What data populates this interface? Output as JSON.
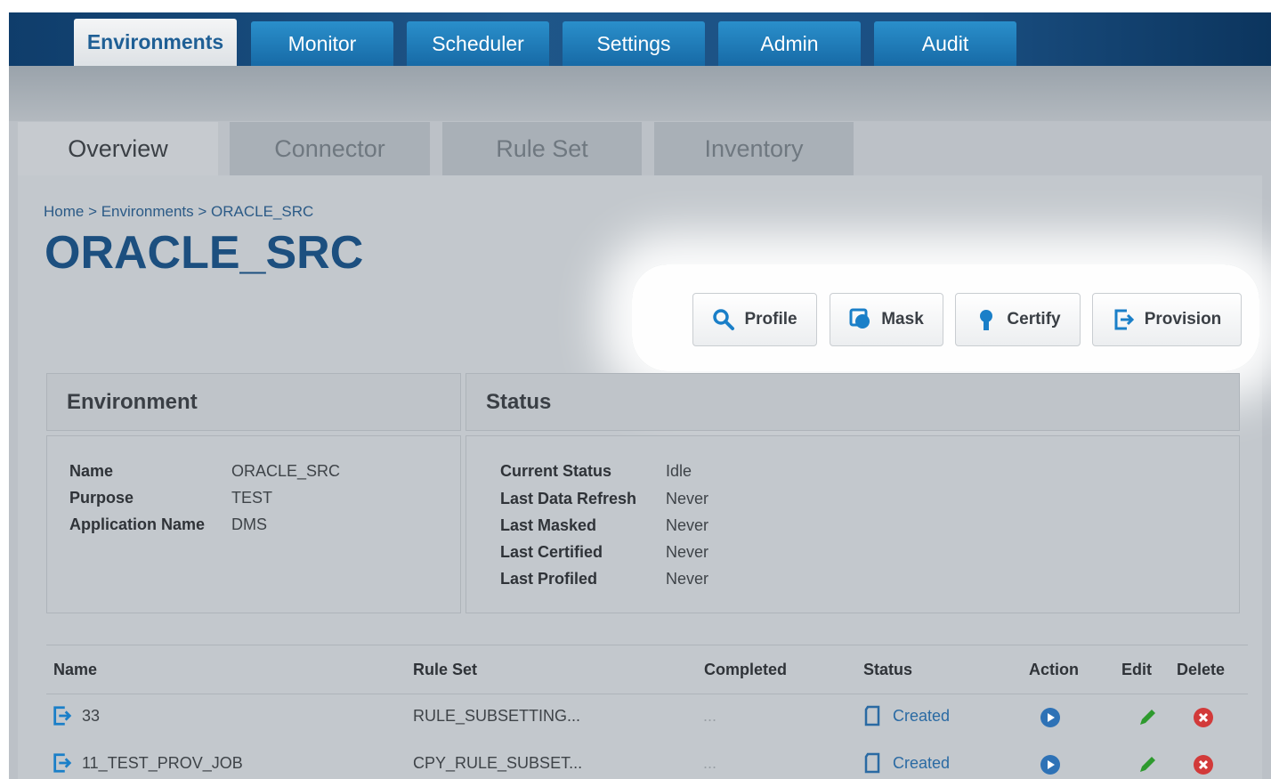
{
  "main_tabs": [
    "Environments",
    "Monitor",
    "Scheduler",
    "Settings",
    "Admin",
    "Audit"
  ],
  "sub_tabs": [
    "Overview",
    "Connector",
    "Rule Set",
    "Inventory"
  ],
  "breadcrumb": "Home > Environments > ORACLE_SRC",
  "page_title": "ORACLE_SRC",
  "actions": {
    "profile": "Profile",
    "mask": "Mask",
    "certify": "Certify",
    "provision": "Provision"
  },
  "environment": {
    "header": "Environment",
    "fields": [
      {
        "label": "Name",
        "value": "ORACLE_SRC"
      },
      {
        "label": "Purpose",
        "value": "TEST"
      },
      {
        "label": "Application Name",
        "value": "DMS"
      }
    ]
  },
  "status": {
    "header": "Status",
    "fields": [
      {
        "label": "Current Status",
        "value": "Idle"
      },
      {
        "label": "Last Data Refresh",
        "value": "Never"
      },
      {
        "label": "Last Masked",
        "value": "Never"
      },
      {
        "label": "Last Certified",
        "value": "Never"
      },
      {
        "label": "Last Profiled",
        "value": "Never"
      }
    ]
  },
  "jobs_table": {
    "columns": [
      "Name",
      "Rule Set",
      "Completed",
      "Status",
      "Action",
      "Edit",
      "Delete"
    ],
    "rows": [
      {
        "name": "33",
        "rule_set": "RULE_SUBSETTING...",
        "completed": "...",
        "status": "Created"
      },
      {
        "name": "11_TEST_PROV_JOB",
        "rule_set": "CPY_RULE_SUBSET...",
        "completed": "...",
        "status": "Created"
      }
    ]
  },
  "colors": {
    "brand_blue": "#1c4f7f",
    "tab_blue": "#176aa6",
    "link_blue": "#2a6aa3",
    "delete_red": "#d23a3a",
    "edit_green": "#2e9a2e"
  },
  "icons": {
    "profile": "magnifier-icon",
    "mask": "mask-icon",
    "certify": "ribbon-icon",
    "provision": "export-icon",
    "status": "document-icon",
    "action": "play-icon",
    "edit": "pencil-icon",
    "delete": "delete-icon"
  }
}
